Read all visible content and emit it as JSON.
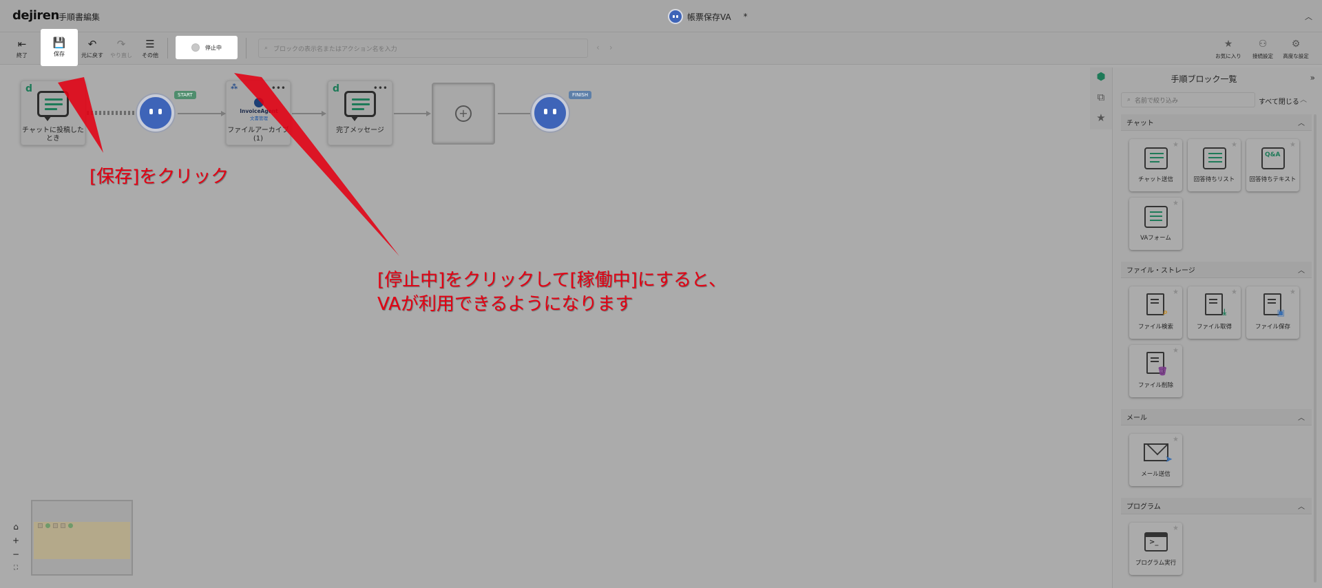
{
  "app": {
    "logo": "dejiren",
    "page_title": "手順書編集",
    "document_name": "帳票保存VA",
    "modified_marker": "*"
  },
  "toolbar": {
    "exit_label": "終了",
    "save_label": "保存",
    "undo_label": "元に戻す",
    "redo_label": "やり直し",
    "more_label": "その他",
    "status_label": "停止中",
    "search_placeholder": "ブロックの表示名またはアクション名を入力",
    "favorites_label": "お気に入り",
    "connection_label": "接続設定",
    "advanced_label": "高度な設定"
  },
  "canvas": {
    "nodes": {
      "trigger_label_1": "チャットに投稿した",
      "trigger_label_2": "とき",
      "start_tag": "START",
      "invoice_brand": "InvoiceAgent",
      "invoice_sub": "文書管理",
      "archive_label_1": "ファイルアーカイブ",
      "archive_label_2": "(1)",
      "complete_label": "完了メッセージ",
      "finish_tag": "FINISH"
    },
    "annotations": {
      "save_note": "[保存]をクリック",
      "status_note_1": "[停止中]をクリックして[稼働中]にすると、",
      "status_note_2": "VAが利用できるようになります"
    }
  },
  "panel": {
    "title": "手順ブロック一覧",
    "filter_placeholder": "名前で絞り込み",
    "close_all": "すべて閉じる",
    "sections": {
      "chat": {
        "title": "チャット",
        "items": [
          "チャット送信",
          "回答待ちリスト",
          "回答待ちテキスト",
          "VAフォーム"
        ]
      },
      "file": {
        "title": "ファイル・ストレージ",
        "items": [
          "ファイル検索",
          "ファイル取得",
          "ファイル保存",
          "ファイル削除"
        ]
      },
      "mail": {
        "title": "メール",
        "items": [
          "メール送信"
        ]
      },
      "program": {
        "title": "プログラム",
        "items": [
          "プログラム実行"
        ]
      }
    }
  },
  "colors": {
    "accent_green": "#1e7a58",
    "va_blue": "#3e64b8",
    "annotation_red": "#e30012"
  }
}
